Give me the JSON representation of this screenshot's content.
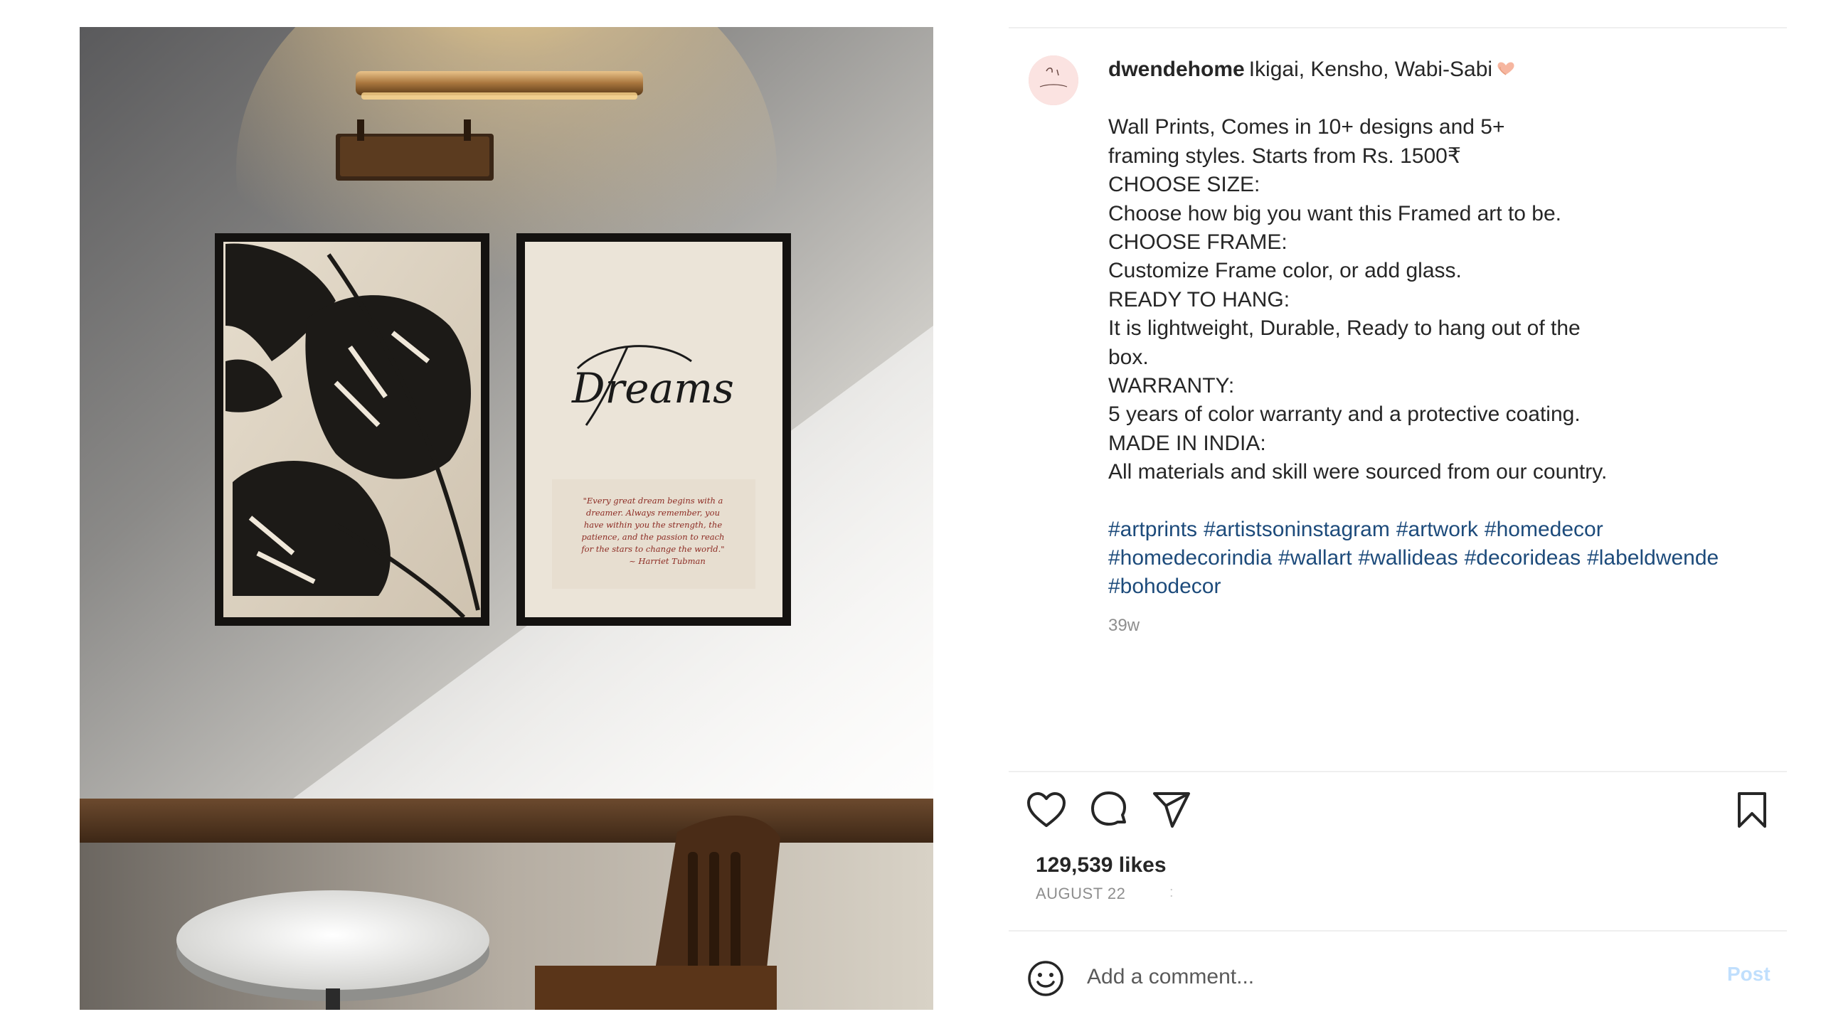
{
  "post": {
    "username": "dwendehome",
    "caption_first": "Ikigai, Kensho, Wabi-Sabi",
    "caption_lines": [
      "Wall Prints, Comes in 10+ designs and 5+",
      "framing styles. Starts from Rs. 1500₹",
      "CHOOSE SIZE:",
      "Choose how big you want this Framed art to be.",
      "CHOOSE FRAME:",
      "Customize Frame color, or add glass.",
      "READY TO HANG:",
      "It is lightweight, Durable, Ready to hang out of the",
      "box.",
      "WARRANTY:",
      "5 years of color warranty and a protective coating.",
      "MADE IN INDIA:",
      "All materials and skill were sourced from our country."
    ],
    "hashtag_lines": [
      [
        "#artprints",
        "#artistsoninstagram",
        "#artwork",
        "#homedecor"
      ],
      [
        "#homedecorindia",
        "#wallart",
        "#wallideas",
        "#decorideas",
        "#labeldwende"
      ],
      [
        "#bohodecor"
      ]
    ],
    "timestamp": "39w",
    "likes": "129,539 likes",
    "date": "AUGUST 22",
    "date_marker": ":"
  },
  "artwork": {
    "right_print_title": "Dreams",
    "quote_lines": [
      "\"Every great dream begins with a",
      "dreamer. Always remember, you",
      "have within you the strength, the",
      "patience, and the passion to reach",
      "for the stars to change the world.\"",
      "~ Harriet Tubman"
    ]
  },
  "comment": {
    "placeholder": "Add a comment...",
    "post_label": "Post"
  },
  "icons": {
    "like": "heart-icon",
    "comment": "comment-icon",
    "share": "share-icon",
    "save": "bookmark-icon",
    "emoji": "emoji-icon",
    "caption_emoji": "heart-hands-emoji"
  },
  "colors": {
    "hashtag": "#1d4b7b",
    "muted": "#8e8e8e",
    "post_button_disabled": "#c0dffd",
    "divider": "#efefef"
  }
}
